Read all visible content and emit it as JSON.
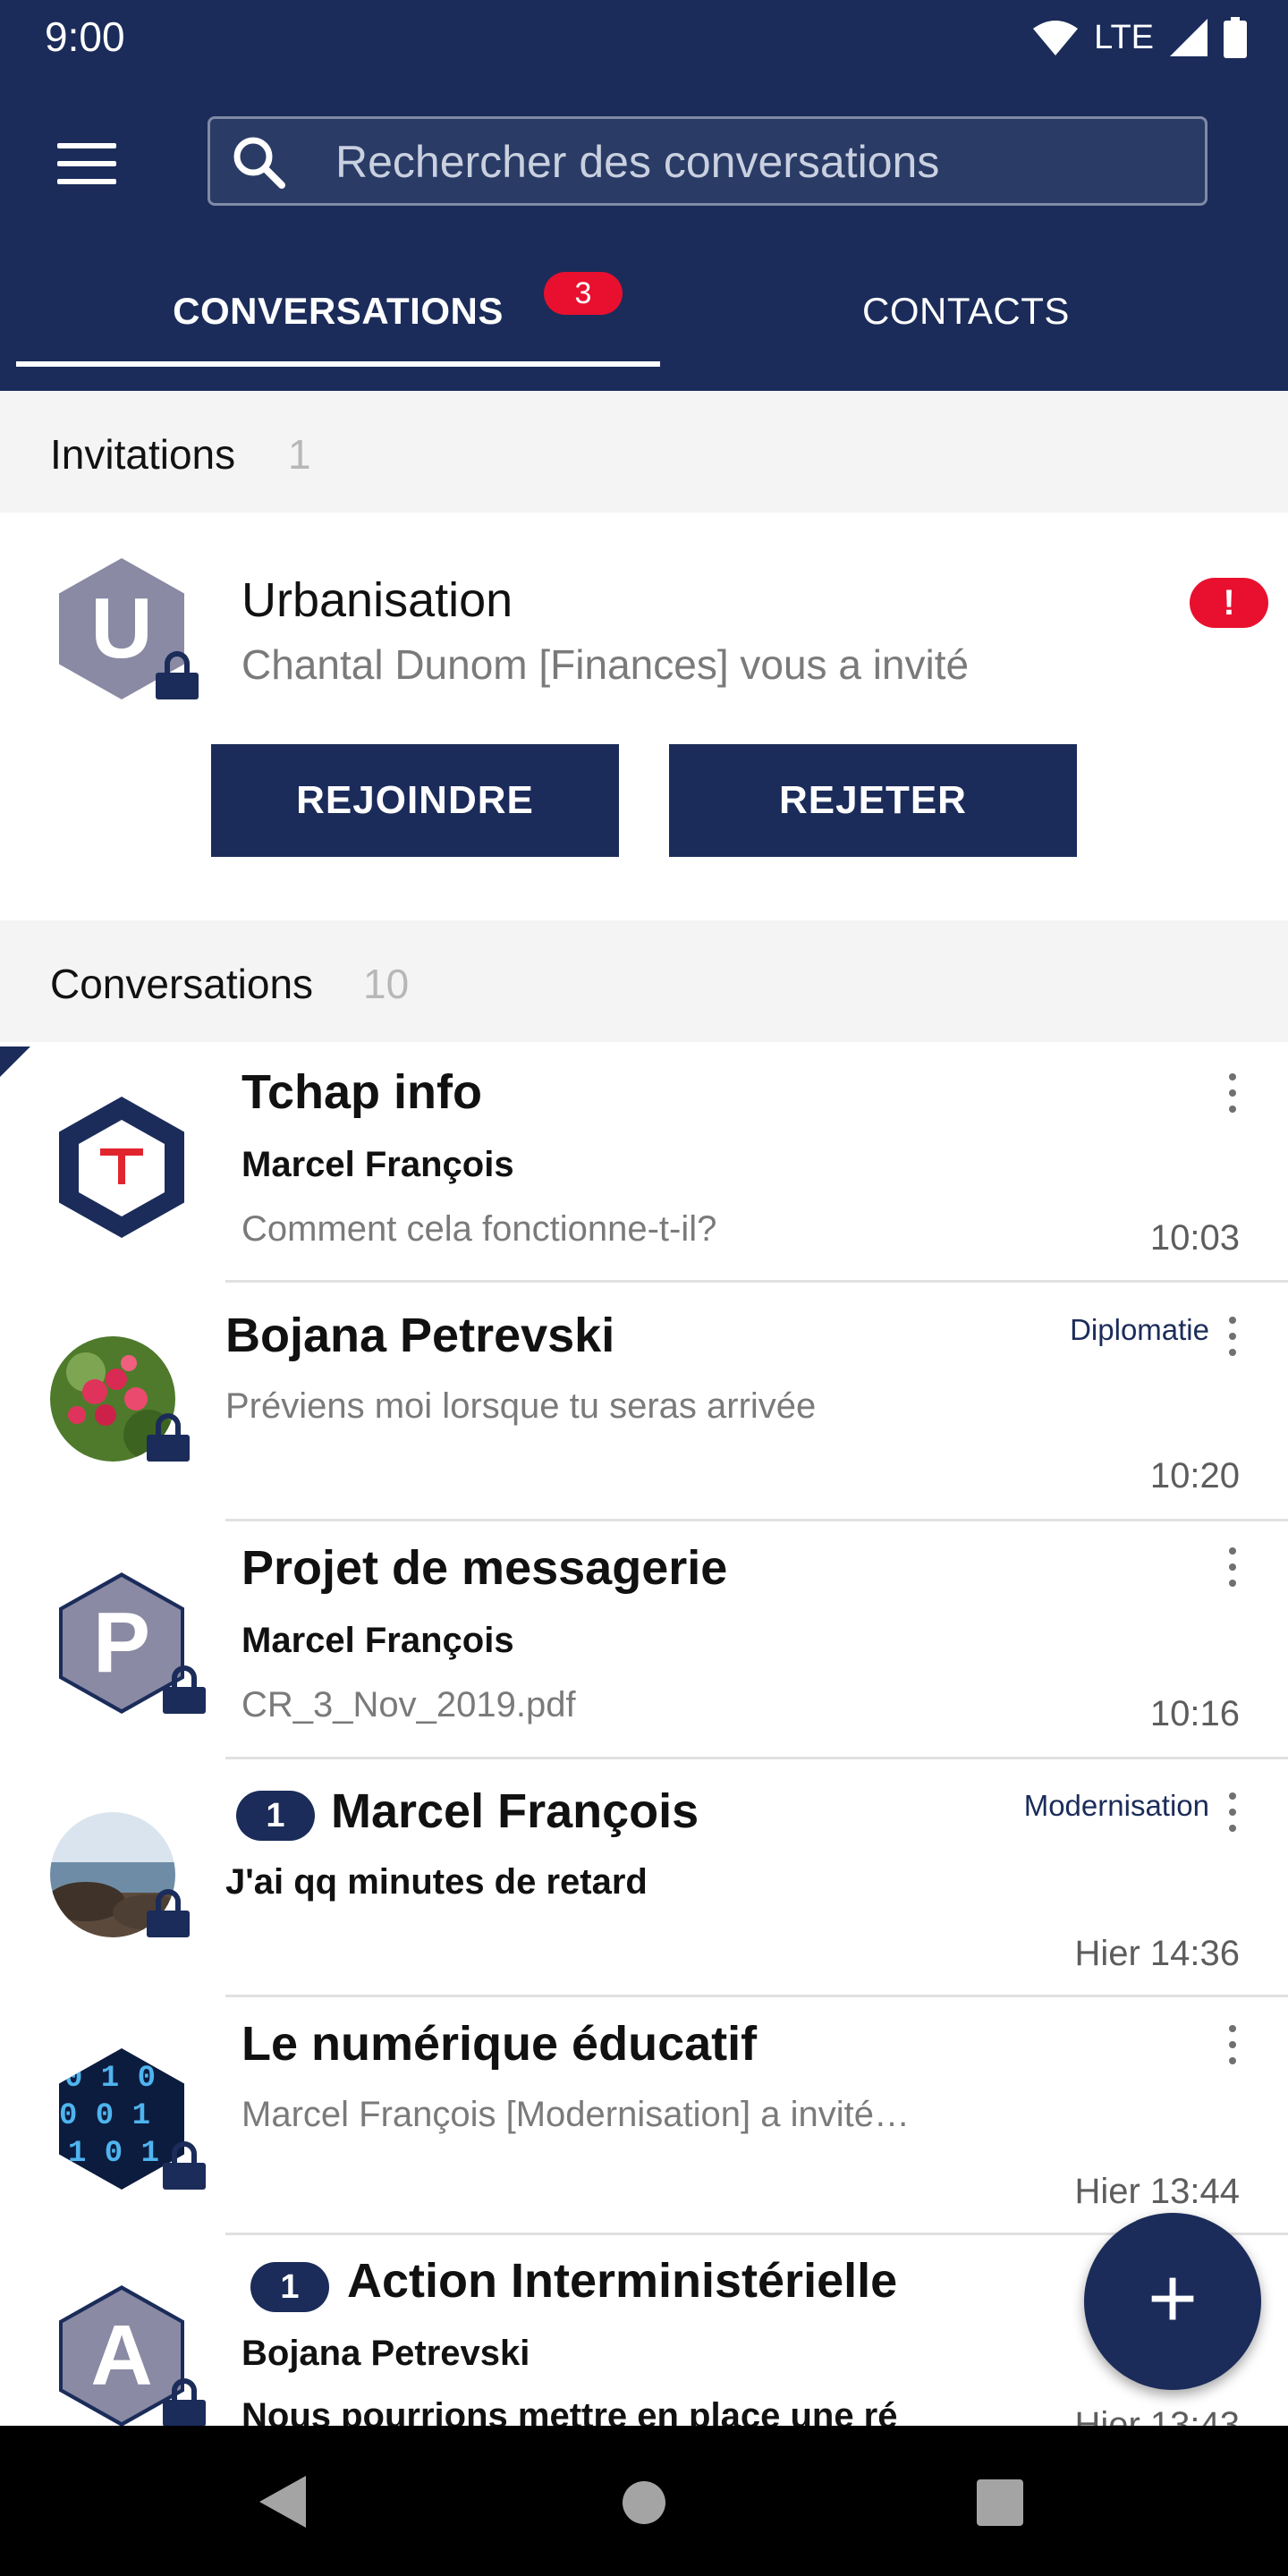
{
  "status_bar": {
    "time": "9:00",
    "network": "LTE"
  },
  "header": {
    "search_placeholder": "Rechercher des conversations",
    "tabs": [
      {
        "label": "CONVERSATIONS",
        "badge": "3",
        "active": true
      },
      {
        "label": "CONTACTS",
        "active": false
      }
    ]
  },
  "invitations": {
    "title": "Invitations",
    "count": "1",
    "items": [
      {
        "avatar_letter": "U",
        "name": "Urbanisation",
        "subtitle": "Chantal Dunom [Finances] vous a invité",
        "alert": "!",
        "join_label": "REJOINDRE",
        "reject_label": "REJETER"
      }
    ]
  },
  "conversations": {
    "title": "Conversations",
    "count": "10",
    "items": [
      {
        "name": "Tchap info",
        "sender": "Marcel François",
        "message": "Comment cela fonctionne-t-il?",
        "time": "10:03"
      },
      {
        "name": "Bojana Petrevski",
        "tag": "Diplomatie",
        "message": "Préviens moi lorsque tu seras arrivée",
        "time": "10:20"
      },
      {
        "avatar_letter": "P",
        "name": "Projet de messagerie",
        "sender": "Marcel François",
        "message": "CR_3_Nov_2019.pdf",
        "time": "10:16"
      },
      {
        "unread": "1",
        "name": "Marcel François",
        "tag": "Modernisation",
        "message": "J'ai qq minutes de retard",
        "time": "Hier 14:36"
      },
      {
        "name": "Le numérique éducatif",
        "message": "Marcel François [Modernisation] a invité…",
        "time": "Hier 13:44"
      },
      {
        "unread": "1",
        "avatar_letter": "A",
        "name": "Action Interministérielle",
        "sender": "Bojana Petrevski",
        "message": "Nous pourrions mettre en place une ré",
        "time": "Hier 13:43"
      }
    ]
  },
  "fab": {
    "label": "+"
  },
  "colors": {
    "brand": "#1b2c5a",
    "badge": "#e8102e",
    "section_bg": "#f4f4f5"
  }
}
